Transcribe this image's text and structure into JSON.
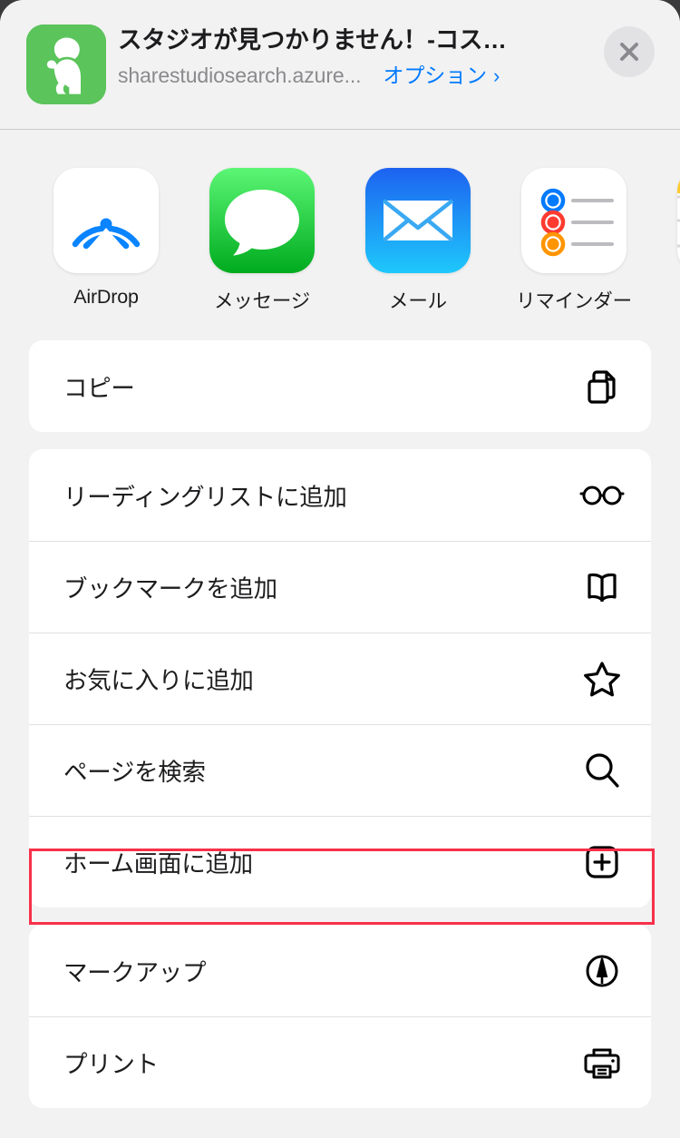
{
  "sheet": {
    "header": {
      "app_icon_name": "sitting-person-icon",
      "app_icon_color": "#5bc45b",
      "title": "スタジオが見つかりません！-コス…",
      "subtitle": "sharestudiosearch.azure...",
      "options_label": "オプション",
      "options_chevron": "›",
      "close_icon": "close-icon",
      "accent_color": "#007aff"
    },
    "apps": [
      {
        "label": "AirDrop",
        "icon": "airdrop-icon"
      },
      {
        "label": "メッセージ",
        "icon": "messages-icon"
      },
      {
        "label": "メール",
        "icon": "mail-icon"
      },
      {
        "label": "リマインダー",
        "icon": "reminders-icon"
      },
      {
        "label": "",
        "icon": "notes-icon"
      }
    ],
    "action_groups": [
      {
        "actions": [
          {
            "label": "コピー",
            "icon": "copy-icon"
          }
        ]
      },
      {
        "actions": [
          {
            "label": "リーディングリストに追加",
            "icon": "glasses-icon"
          },
          {
            "label": "ブックマークを追加",
            "icon": "book-icon"
          },
          {
            "label": "お気に入りに追加",
            "icon": "star-icon"
          },
          {
            "label": "ページを検索",
            "icon": "search-icon"
          },
          {
            "label": "ホーム画面に追加",
            "icon": "add-to-home-icon"
          }
        ]
      },
      {
        "actions": [
          {
            "label": "マークアップ",
            "icon": "markup-icon"
          },
          {
            "label": "プリント",
            "icon": "print-icon"
          }
        ]
      }
    ],
    "highlight": {
      "target_label": "ホーム画面に追加",
      "color": "#f8304a"
    }
  }
}
